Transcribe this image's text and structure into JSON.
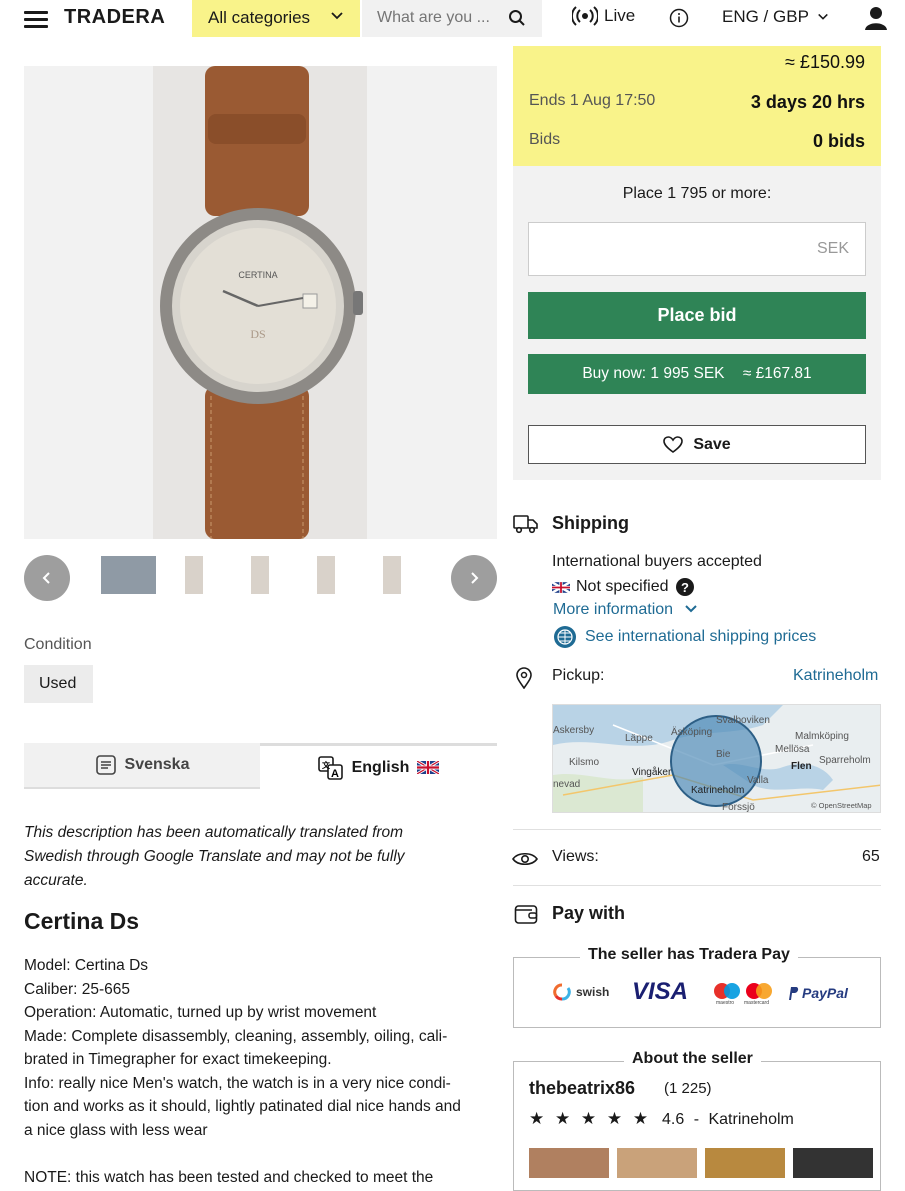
{
  "header": {
    "logo": "TRADERA",
    "categories_label": "All categories",
    "search_placeholder": "What are you ...",
    "live_label": "Live",
    "lang_label": "ENG / GBP"
  },
  "gallery": {
    "thumbnail_count": 6
  },
  "condition": {
    "label": "Condition",
    "value": "Used"
  },
  "description_tabs": {
    "swedish": "Svenska",
    "english": "English"
  },
  "description": {
    "translation_note_lines": [
      "This description has been automatically translated from",
      "Swedish through Google Translate and may not be fully",
      "accurate."
    ],
    "title": "Certina Ds",
    "lines": [
      "Model: Certina Ds",
      "Caliber: 25-665",
      "Operation: Automatic, turned up by wrist movement",
      "Made: Complete disassembly, cleaning, assembly, oiling, cali-",
      "brated in Timegrapher for exact timekeeping.",
      "Info: really nice Men's watch, the watch is in a very nice condi-",
      "tion and works as it should, lightly patinated dial nice hands and",
      "a nice glass with less wear",
      "",
      "NOTE: this watch has been tested and checked to meet the"
    ]
  },
  "bid": {
    "price_gbp": "≈ £150.99",
    "ends_label": "Ends 1 Aug 17:50",
    "time_left": "3 days 20 hrs",
    "bids_label": "Bids",
    "bids_value": "0 bids",
    "place_hint": "Place 1 795 or more:",
    "currency": "SEK",
    "place_bid_label": "Place bid",
    "buy_now_label": "Buy now: 1 995 SEK",
    "buy_now_gbp": "≈ £167.81",
    "save_label": "Save"
  },
  "shipping": {
    "title": "Shipping",
    "intl_buyers": "International buyers accepted",
    "not_specified": "Not specified",
    "more_info": "More information",
    "see_intl_prices": "See international shipping prices",
    "pickup_label": "Pickup:",
    "pickup_value": "Katrineholm"
  },
  "map": {
    "labels": [
      "Askersby",
      "Läppe",
      "Äsköping",
      "Svalboviken",
      "Malmköping",
      "Mellösa",
      "Kilsmo",
      "Vingåker",
      "Bie",
      "Flen",
      "Sparreholm",
      "nevad",
      "Katrineholm",
      "Valla",
      "Forssjö"
    ],
    "attribution": "© OpenStreetMap"
  },
  "views": {
    "label": "Views:",
    "value": "65"
  },
  "payment": {
    "title": "Pay with",
    "box_title": "The seller has Tradera Pay",
    "methods": [
      "swish",
      "VISA",
      "maestro",
      "mastercard",
      "PayPal"
    ]
  },
  "seller": {
    "box_title": "About the seller",
    "name": "thebeatrix86",
    "count": "(1 225)",
    "stars": "★ ★ ★ ★ ★",
    "rating": "4.6",
    "separator": "-",
    "location": "Katrineholm"
  },
  "colors": {
    "accent_yellow": "#f9f38a",
    "green": "#2f8456",
    "link": "#1f6b94"
  }
}
